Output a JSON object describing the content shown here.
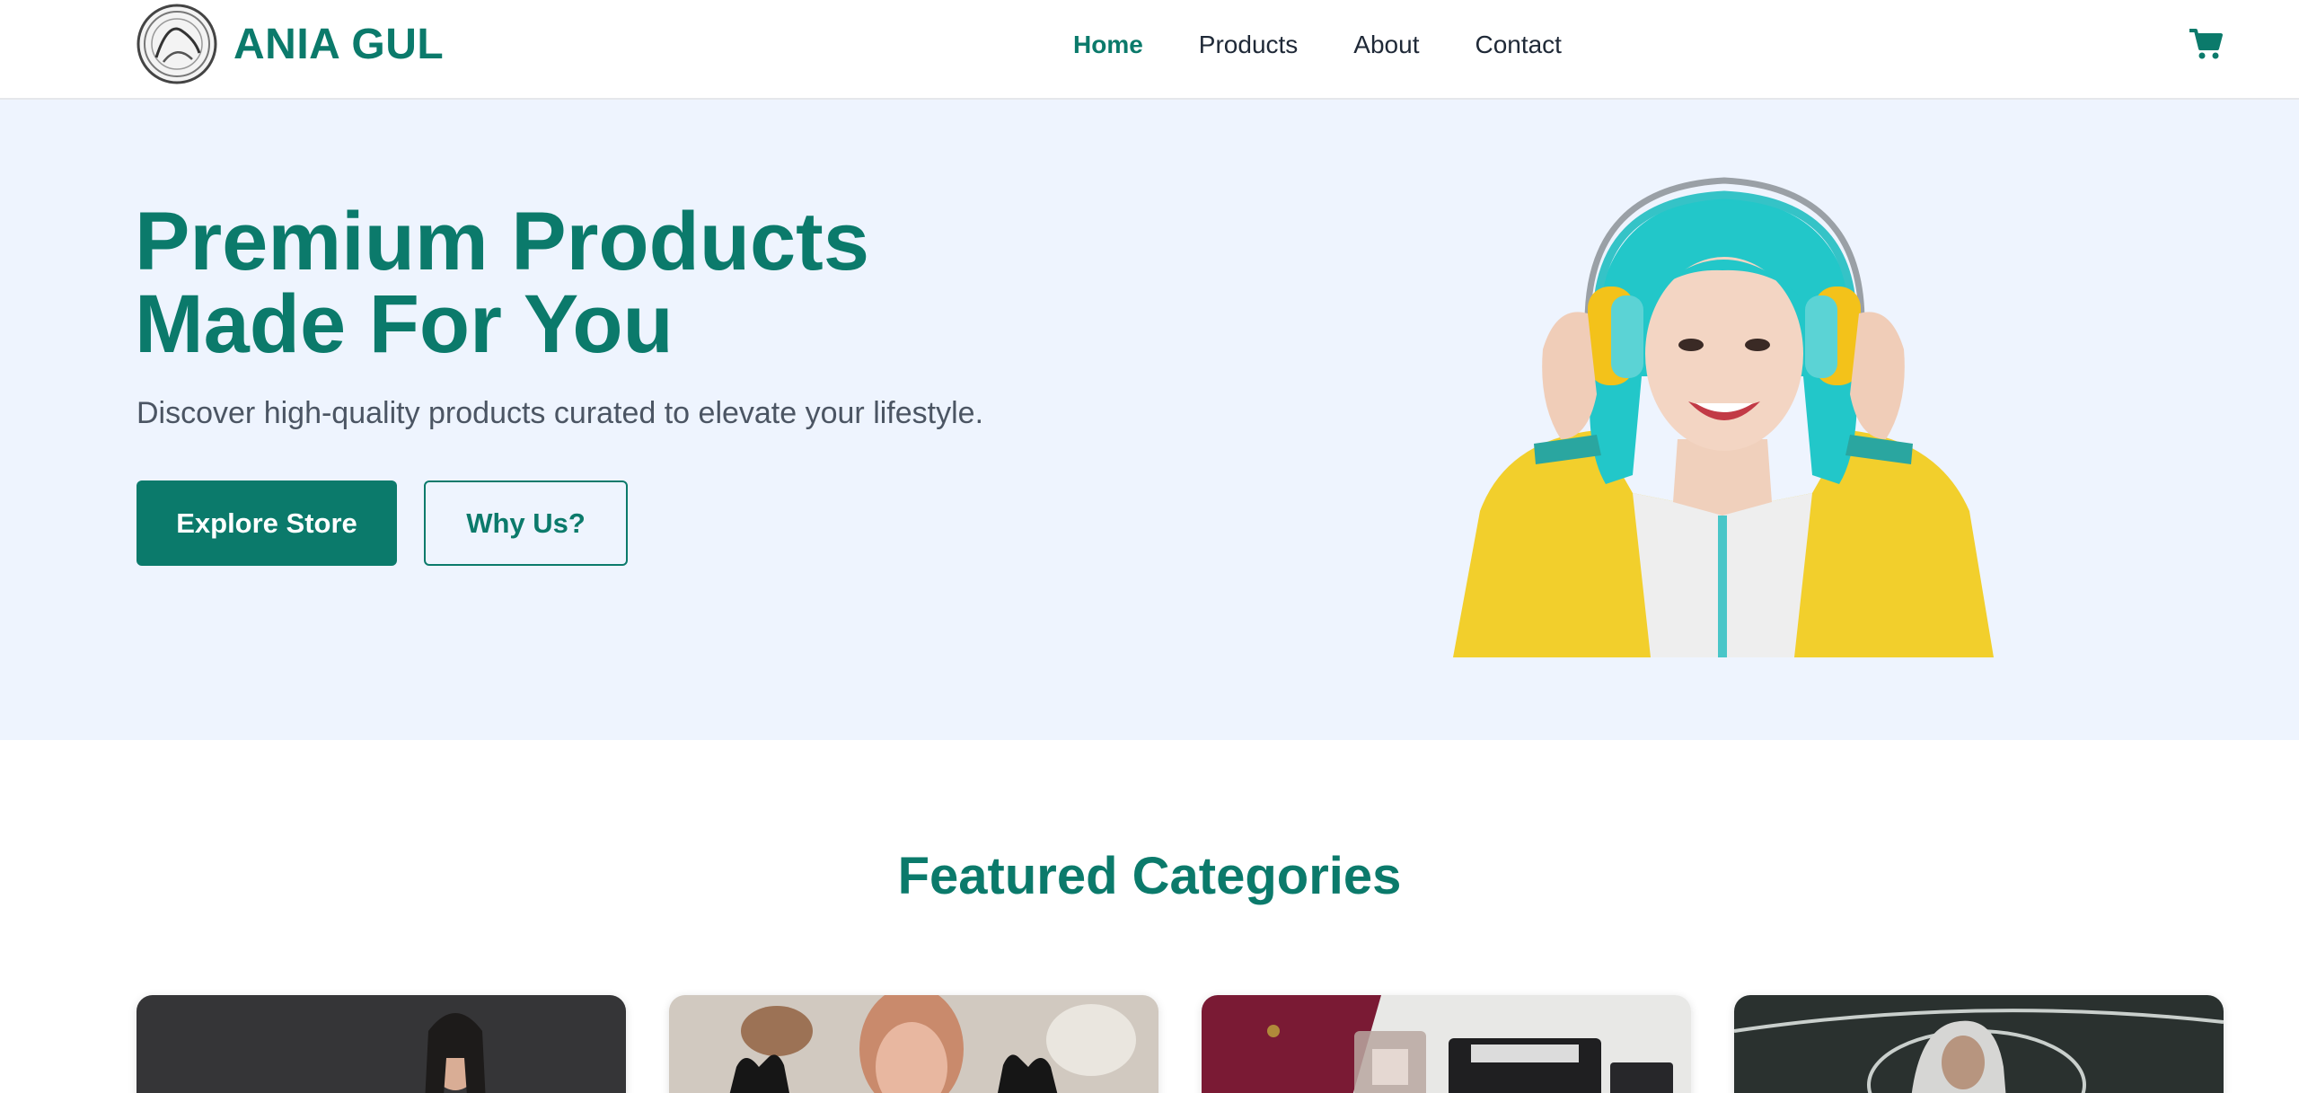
{
  "header": {
    "brand": "ANIA GUL",
    "logo_icon": "monogram-seal-icon",
    "nav": [
      {
        "label": "Home",
        "active": true
      },
      {
        "label": "Products",
        "active": false
      },
      {
        "label": "About",
        "active": false
      },
      {
        "label": "Contact",
        "active": false
      }
    ],
    "cart_icon": "shopping-cart-icon"
  },
  "hero": {
    "title_line1": "Premium Products",
    "title_line2": "Made For You",
    "subtitle": "Discover high-quality products curated to elevate your lifestyle.",
    "primary_button": "Explore Store",
    "secondary_button": "Why Us?",
    "image": "woman-with-headphones-photo"
  },
  "featured": {
    "title": "Featured Categories",
    "cards": [
      {
        "image": "fitness-woman-photo"
      },
      {
        "image": "woman-with-gloves-photo"
      },
      {
        "image": "perfume-and-wallet-photo"
      },
      {
        "image": "hoodie-man-photo"
      }
    ]
  },
  "colors": {
    "brand": "#0b7a6b",
    "hero_bg": "#eef4fe",
    "text": "#1f2937",
    "muted": "#4b5563"
  }
}
